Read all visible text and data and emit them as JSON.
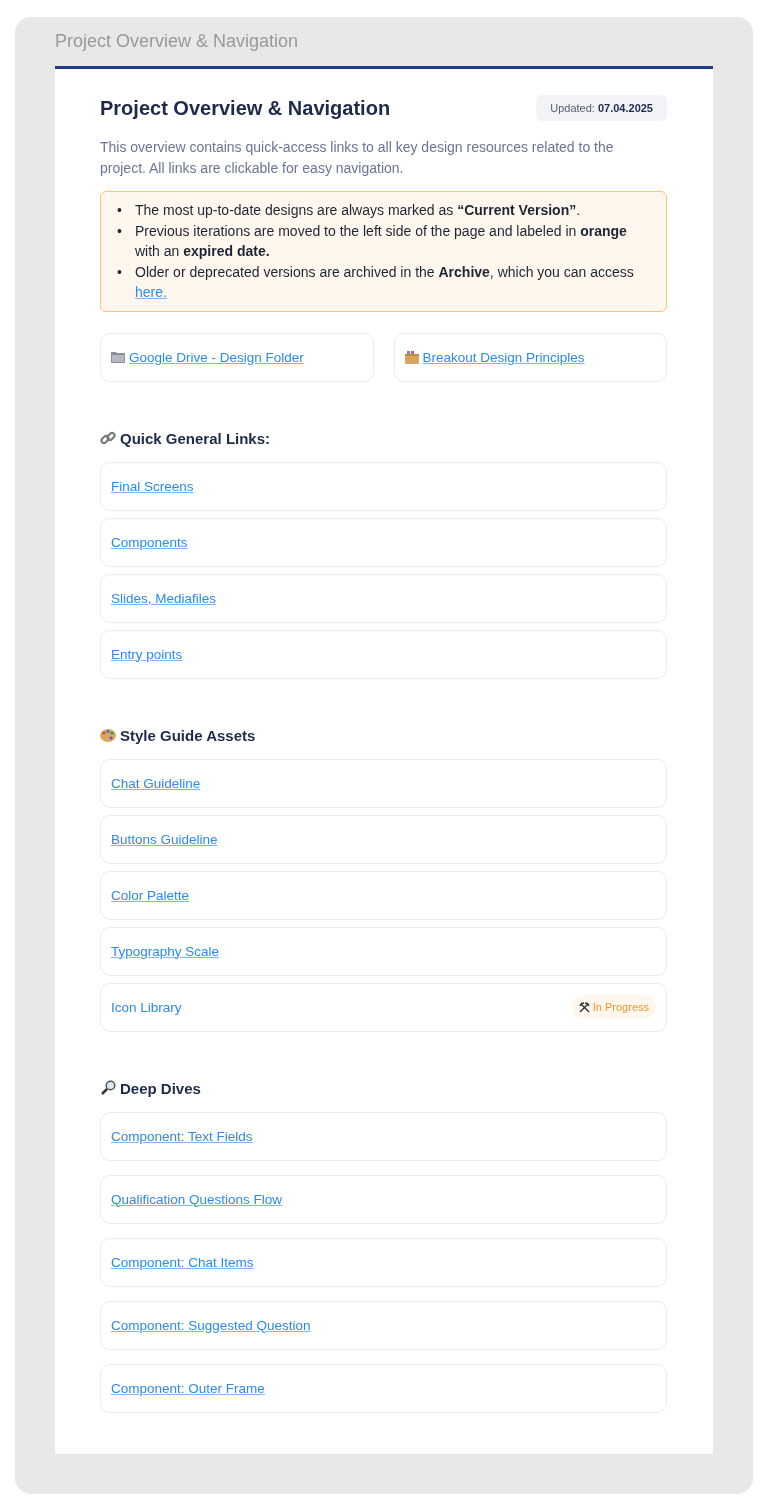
{
  "window": {
    "title": "Project Overview & Navigation"
  },
  "header": {
    "title": "Project Overview & Navigation",
    "updated_label": "Updated:",
    "updated_date": "07.04.2025"
  },
  "description": "This overview contains quick-access links to all key design resources related to the project. All links are clickable for easy navigation.",
  "notice": [
    {
      "bullet": "•",
      "text": "The most up-to-date designs are always marked as **“Current Version”**."
    },
    {
      "bullet": "•",
      "text": "Previous iterations are moved to the left side of the page and labeled in **orange** with an **expired date.**"
    },
    {
      "bullet": "•",
      "text": "Older or deprecated versions are archived in the **Archive**, which you can access",
      "link": "here."
    }
  ],
  "resource_cards": [
    {
      "label": "Google Drive - Design Folder"
    },
    {
      "label": "Breakout Design Principles"
    }
  ],
  "sections": [
    {
      "title": "Quick General Links:",
      "links": [
        {
          "label": "Final Screens",
          "linked": true
        },
        {
          "label": "Components",
          "linked": true
        },
        {
          "label": "Slides, Mediafiles",
          "linked": true
        },
        {
          "label": "Entry points",
          "linked": true
        }
      ]
    },
    {
      "title": "Style Guide Assets",
      "links": [
        {
          "label": "Chat Guideline",
          "linked": true
        },
        {
          "label": "Buttons Guideline",
          "linked": true
        },
        {
          "label": "Color Palette",
          "linked": true
        },
        {
          "label": "Typography Scale",
          "linked": true
        },
        {
          "label": "Icon Library",
          "linked": false,
          "status": "In Progress"
        }
      ]
    },
    {
      "title": "Deep Dives",
      "links": [
        {
          "label": "Component: Text Fields",
          "linked": true
        },
        {
          "label": "Qualification Questions Flow",
          "linked": true
        },
        {
          "label": "Component: Chat Items",
          "linked": true
        },
        {
          "label": "Component: Suggested Question",
          "linked": true
        },
        {
          "label": "Component: Outer Frame",
          "linked": true
        }
      ]
    }
  ]
}
